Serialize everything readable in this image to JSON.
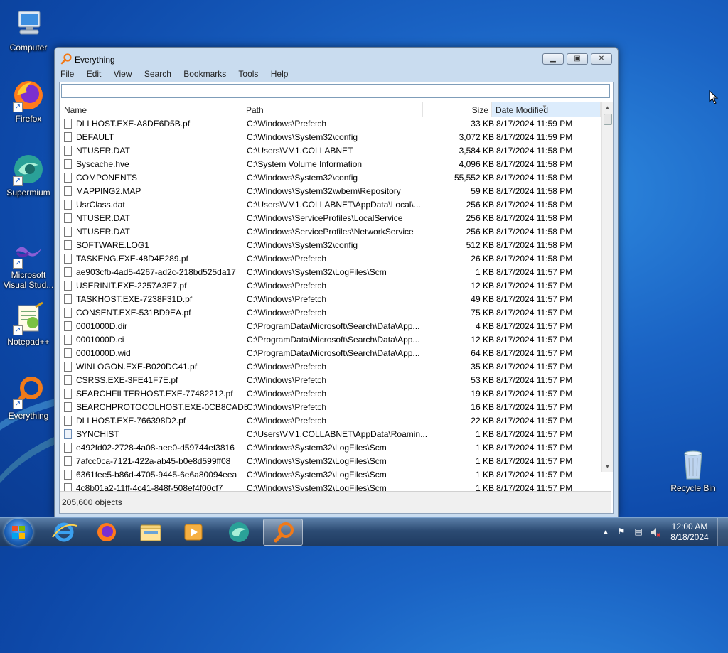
{
  "desktop": {
    "icons": [
      {
        "label": "Computer"
      },
      {
        "label": "Firefox"
      },
      {
        "label": "Supermium"
      },
      {
        "label": "Microsoft Visual Stud..."
      },
      {
        "label": "Notepad++"
      },
      {
        "label": "Everything"
      },
      {
        "label": "Recycle Bin"
      }
    ]
  },
  "window": {
    "title": "Everything",
    "menu": [
      "File",
      "Edit",
      "View",
      "Search",
      "Bookmarks",
      "Tools",
      "Help"
    ],
    "search": {
      "value": "",
      "placeholder": ""
    },
    "columns": {
      "name": "Name",
      "path": "Path",
      "size": "Size",
      "date": "Date Modified"
    },
    "sorted_column": "Date Modified",
    "rows": [
      {
        "name": "DLLHOST.EXE-A8DE6D5B.pf",
        "path": "C:\\Windows\\Prefetch",
        "size": "33 KB",
        "date": "8/17/2024 11:59 PM",
        "icon": "file-icon"
      },
      {
        "name": "DEFAULT",
        "path": "C:\\Windows\\System32\\config",
        "size": "3,072 KB",
        "date": "8/17/2024 11:59 PM",
        "icon": "file-icon"
      },
      {
        "name": "NTUSER.DAT",
        "path": "C:\\Users\\VM1.COLLABNET",
        "size": "3,584 KB",
        "date": "8/17/2024 11:58 PM",
        "icon": "file-icon"
      },
      {
        "name": "Syscache.hve",
        "path": "C:\\System Volume Information",
        "size": "4,096 KB",
        "date": "8/17/2024 11:58 PM",
        "icon": "file-icon"
      },
      {
        "name": "COMPONENTS",
        "path": "C:\\Windows\\System32\\config",
        "size": "55,552 KB",
        "date": "8/17/2024 11:58 PM",
        "icon": "file-icon"
      },
      {
        "name": "MAPPING2.MAP",
        "path": "C:\\Windows\\System32\\wbem\\Repository",
        "size": "59 KB",
        "date": "8/17/2024 11:58 PM",
        "icon": "file-icon"
      },
      {
        "name": "UsrClass.dat",
        "path": "C:\\Users\\VM1.COLLABNET\\AppData\\Local\\...",
        "size": "256 KB",
        "date": "8/17/2024 11:58 PM",
        "icon": "file-icon"
      },
      {
        "name": "NTUSER.DAT",
        "path": "C:\\Windows\\ServiceProfiles\\LocalService",
        "size": "256 KB",
        "date": "8/17/2024 11:58 PM",
        "icon": "file-icon"
      },
      {
        "name": "NTUSER.DAT",
        "path": "C:\\Windows\\ServiceProfiles\\NetworkService",
        "size": "256 KB",
        "date": "8/17/2024 11:58 PM",
        "icon": "file-icon"
      },
      {
        "name": "SOFTWARE.LOG1",
        "path": "C:\\Windows\\System32\\config",
        "size": "512 KB",
        "date": "8/17/2024 11:58 PM",
        "icon": "file-icon"
      },
      {
        "name": "TASKENG.EXE-48D4E289.pf",
        "path": "C:\\Windows\\Prefetch",
        "size": "26 KB",
        "date": "8/17/2024 11:58 PM",
        "icon": "file-icon"
      },
      {
        "name": "ae903cfb-4ad5-4267-ad2c-218bd525da17",
        "path": "C:\\Windows\\System32\\LogFiles\\Scm",
        "size": "1 KB",
        "date": "8/17/2024 11:57 PM",
        "icon": "file-icon"
      },
      {
        "name": "USERINIT.EXE-2257A3E7.pf",
        "path": "C:\\Windows\\Prefetch",
        "size": "12 KB",
        "date": "8/17/2024 11:57 PM",
        "icon": "file-icon"
      },
      {
        "name": "TASKHOST.EXE-7238F31D.pf",
        "path": "C:\\Windows\\Prefetch",
        "size": "49 KB",
        "date": "8/17/2024 11:57 PM",
        "icon": "file-icon"
      },
      {
        "name": "CONSENT.EXE-531BD9EA.pf",
        "path": "C:\\Windows\\Prefetch",
        "size": "75 KB",
        "date": "8/17/2024 11:57 PM",
        "icon": "file-icon"
      },
      {
        "name": "0001000D.dir",
        "path": "C:\\ProgramData\\Microsoft\\Search\\Data\\App...",
        "size": "4 KB",
        "date": "8/17/2024 11:57 PM",
        "icon": "file-icon"
      },
      {
        "name": "0001000D.ci",
        "path": "C:\\ProgramData\\Microsoft\\Search\\Data\\App...",
        "size": "12 KB",
        "date": "8/17/2024 11:57 PM",
        "icon": "file-icon"
      },
      {
        "name": "0001000D.wid",
        "path": "C:\\ProgramData\\Microsoft\\Search\\Data\\App...",
        "size": "64 KB",
        "date": "8/17/2024 11:57 PM",
        "icon": "file-icon"
      },
      {
        "name": "WINLOGON.EXE-B020DC41.pf",
        "path": "C:\\Windows\\Prefetch",
        "size": "35 KB",
        "date": "8/17/2024 11:57 PM",
        "icon": "file-icon"
      },
      {
        "name": "CSRSS.EXE-3FE41F7E.pf",
        "path": "C:\\Windows\\Prefetch",
        "size": "53 KB",
        "date": "8/17/2024 11:57 PM",
        "icon": "file-icon"
      },
      {
        "name": "SEARCHFILTERHOST.EXE-77482212.pf",
        "path": "C:\\Windows\\Prefetch",
        "size": "19 KB",
        "date": "8/17/2024 11:57 PM",
        "icon": "file-icon"
      },
      {
        "name": "SEARCHPROTOCOLHOST.EXE-0CB8CADE...",
        "path": "C:\\Windows\\Prefetch",
        "size": "16 KB",
        "date": "8/17/2024 11:57 PM",
        "icon": "file-icon"
      },
      {
        "name": "DLLHOST.EXE-766398D2.pf",
        "path": "C:\\Windows\\Prefetch",
        "size": "22 KB",
        "date": "8/17/2024 11:57 PM",
        "icon": "file-icon"
      },
      {
        "name": "SYNCHIST",
        "path": "C:\\Users\\VM1.COLLABNET\\AppData\\Roamin...",
        "size": "1 KB",
        "date": "8/17/2024 11:57 PM",
        "icon": "system-file-icon"
      },
      {
        "name": "e492fd02-2728-4a08-aee0-d59744ef3816",
        "path": "C:\\Windows\\System32\\LogFiles\\Scm",
        "size": "1 KB",
        "date": "8/17/2024 11:57 PM",
        "icon": "file-icon"
      },
      {
        "name": "7afcc0ca-7121-422a-ab45-b0e8d599ff08",
        "path": "C:\\Windows\\System32\\LogFiles\\Scm",
        "size": "1 KB",
        "date": "8/17/2024 11:57 PM",
        "icon": "file-icon"
      },
      {
        "name": "6361fee5-b86d-4705-9445-6e6a80094eea",
        "path": "C:\\Windows\\System32\\LogFiles\\Scm",
        "size": "1 KB",
        "date": "8/17/2024 11:57 PM",
        "icon": "file-icon"
      },
      {
        "name": "4c8b01a2-11ff-4c41-848f-508ef4f00cf7",
        "path": "C:\\Windows\\System32\\LogFiles\\Scm",
        "size": "1 KB",
        "date": "8/17/2024 11:57 PM",
        "icon": "file-icon"
      }
    ],
    "status": "205,600 objects"
  },
  "taskbar": {
    "apps": [
      "internet-explorer-icon",
      "firefox-icon",
      "file-explorer-icon",
      "media-player-icon",
      "supermium-icon",
      "everything-icon"
    ],
    "active_app": "everything-icon",
    "time": "12:00 AM",
    "date": "8/18/2024"
  },
  "colors": {
    "desktop": "#1a63c4",
    "window_frame": "#c9dcef",
    "sorted_header": "#dcecfc",
    "everything_orange": "#f07a1a"
  }
}
